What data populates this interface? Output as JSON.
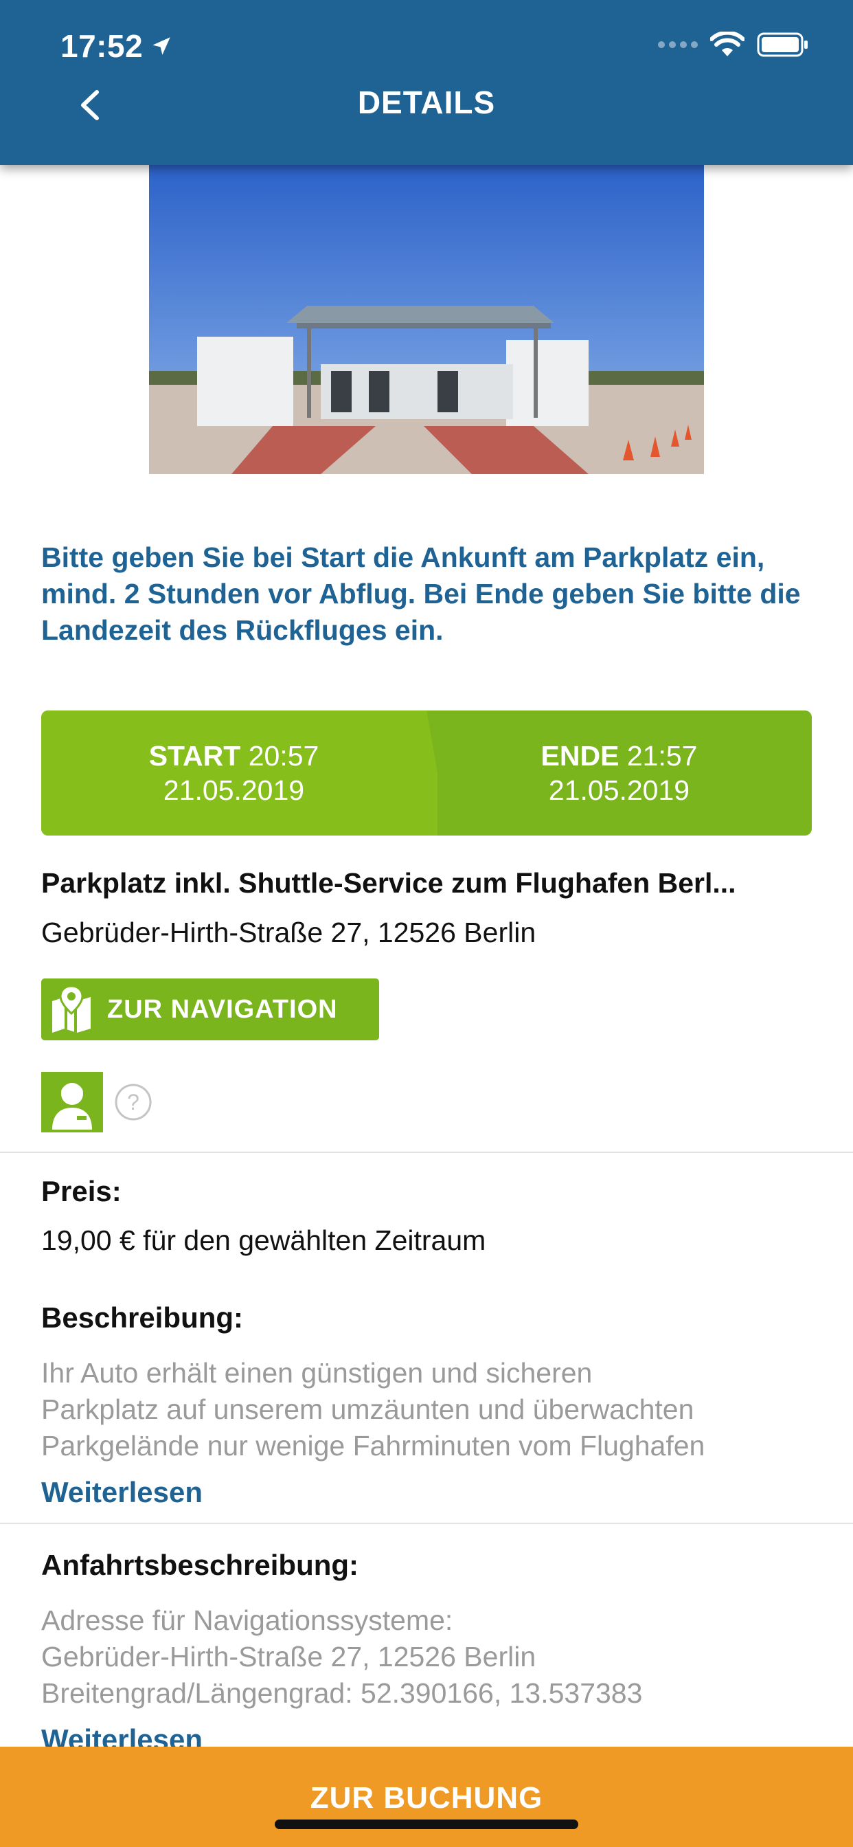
{
  "status_bar": {
    "time": "17:52"
  },
  "header": {
    "title": "DETAILS"
  },
  "notice": "Bitte geben Sie bei Start die Ankunft am Parkplatz ein, mind. 2 Stunden vor Abflug. Bei Ende geben Sie bitte die Landezeit des Rückfluges ein.",
  "timebar": {
    "start_label": "START",
    "start_time": "20:57",
    "start_date": "21.05.2019",
    "end_label": "ENDE",
    "end_time": "21:57",
    "end_date": "21.05.2019"
  },
  "place": {
    "name": "Parkplatz inkl. Shuttle-Service zum Flughafen Berl...",
    "address": "Gebrüder-Hirth-Straße 27, 12526 Berlin",
    "nav_label": "ZUR NAVIGATION"
  },
  "price": {
    "label": "Preis:",
    "text": "19,00 € für den gewählten Zeitraum"
  },
  "description": {
    "label": "Beschreibung:",
    "lines": [
      "Ihr Auto erhält einen günstigen und sicheren",
      "Parkplatz auf unserem umzäunten und überwachten",
      "Parkgelände nur wenige Fahrminuten vom Flughafen"
    ],
    "read_more": "Weiterlesen"
  },
  "directions": {
    "label": "Anfahrtsbeschreibung:",
    "lines": [
      "Adresse für Navigationssysteme:",
      "Gebrüder-Hirth-Straße 27, 12526 Berlin",
      "Breitengrad/Längengrad: 52.390166, 13.537383"
    ],
    "read_more": "Weiterlesen"
  },
  "footer": {
    "label": "ZUR BUCHUNG"
  },
  "colors": {
    "header": "#1f6394",
    "accent_green": "#7ab51d",
    "footer_orange": "#ee9a25",
    "link_blue": "#1f6394"
  },
  "icons": [
    "location-arrow-icon",
    "wifi-icon",
    "battery-icon",
    "back-chevron-icon",
    "map-pin-icon",
    "service-person-icon",
    "help-icon"
  ]
}
